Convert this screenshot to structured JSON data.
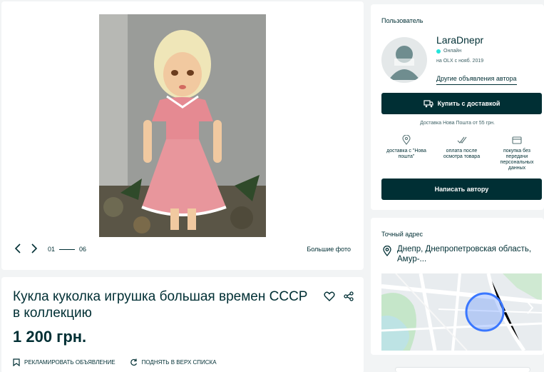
{
  "gallery": {
    "current": "01",
    "total": "06",
    "big_photo_label": "Большие фото"
  },
  "ad": {
    "title": "Кукла куколка игрушка большая времен СССР в коллекцию",
    "price": "1 200 грн.",
    "promote_label": "РЕКЛАМИРОВАТЬ ОБЪЯВЛЕНИЕ",
    "raise_label": "ПОДНЯТЬ В ВЕРХ СПИСКА"
  },
  "user": {
    "section_label": "Пользователь",
    "name": "LaraDnepr",
    "status": "Онлайн",
    "since": "на OLX с нояб. 2019",
    "other_ads": "Другие объявления автора",
    "buy_button": "Купить с доставкой",
    "delivery_note": "Доставка Нова Пошта от 55 грн.",
    "features": [
      {
        "label": "доставка с \"Нова пошта\"",
        "icon": "pin-icon"
      },
      {
        "label": "оплата после осмотра товара",
        "icon": "check-icon"
      },
      {
        "label": "покупка без передачи персональных данных",
        "icon": "card-icon"
      }
    ],
    "message_button": "Написать автору"
  },
  "address": {
    "section_label": "Точный адрес",
    "text": "Днепр, Днепропетровская область, Амур-..."
  },
  "colors": {
    "brand_dark": "#002f34",
    "online": "#23e5db",
    "map_circle": "#3a77ff"
  }
}
